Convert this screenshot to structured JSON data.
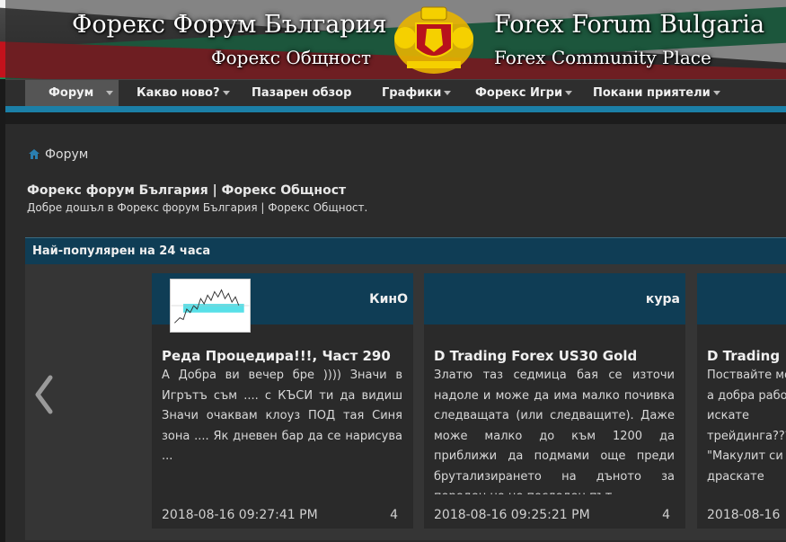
{
  "header": {
    "title_bg": "Форекс Форум България",
    "subtitle_bg": "Форекс Общност",
    "title_en": "Forex Forum Bulgaria",
    "subtitle_en": "Forex Community Place"
  },
  "nav": {
    "items": [
      {
        "label": "Форум",
        "dropdown": true
      },
      {
        "label": "Какво ново?",
        "dropdown": true
      },
      {
        "label": "Пазарен обзор",
        "dropdown": false
      },
      {
        "label": "Графики",
        "dropdown": true
      },
      {
        "label": "Форекс Игри",
        "dropdown": true
      },
      {
        "label": "Покани приятели",
        "dropdown": true
      }
    ]
  },
  "breadcrumb": {
    "label": "Форум"
  },
  "page": {
    "title": "Форекс форум България | Форекс Общност",
    "subtitle": "Добре дошъл в Форекс форум България | Форекс Общност."
  },
  "popular": {
    "title": "Най-популярен на 24 часа",
    "cards": [
      {
        "author": "КинО",
        "title": "Реда Процедира!!!, Част 290",
        "body": "А Добра ви вечер бре )))) Значи в Игрътъ съм .... с КЪСИ ти да видиш Значи очаквам клоуз ПОД тая Синя зона .... Як дневен бар да се нарисува ...",
        "date": "2018-08-16 09:27:41 PM",
        "count": "4"
      },
      {
        "author": "куpa",
        "title": "D Trading Forex US30 Gold",
        "body": "Златю таз седмица бая се източи надоле и може да има малко почивка следващата (или следващите). Даже може малко до към 1200 да приближи да подмами още преди брутализирането на дъното за пореден но не последен път",
        "date": "2018-08-16 09:25:21 PM",
        "count": "4"
      },
      {
        "author": "",
        "title": "D Trading",
        "body": "Поствайте мо?ем да а добра работа Вие искате трейдинга??? от \"Макулит си драскате",
        "date": "2018-08-16",
        "count": ""
      }
    ]
  },
  "colors": {
    "nav_stripe": "#1b7fa7",
    "section_bar": "#0f3d55",
    "flag_green": "#0f8f54",
    "flag_red": "#c4121c"
  },
  "icons": {
    "breadcrumb": "home-icon",
    "carousel_prev": "chevron-left-icon",
    "coat_of_arms": "coat-of-arms-logo"
  }
}
